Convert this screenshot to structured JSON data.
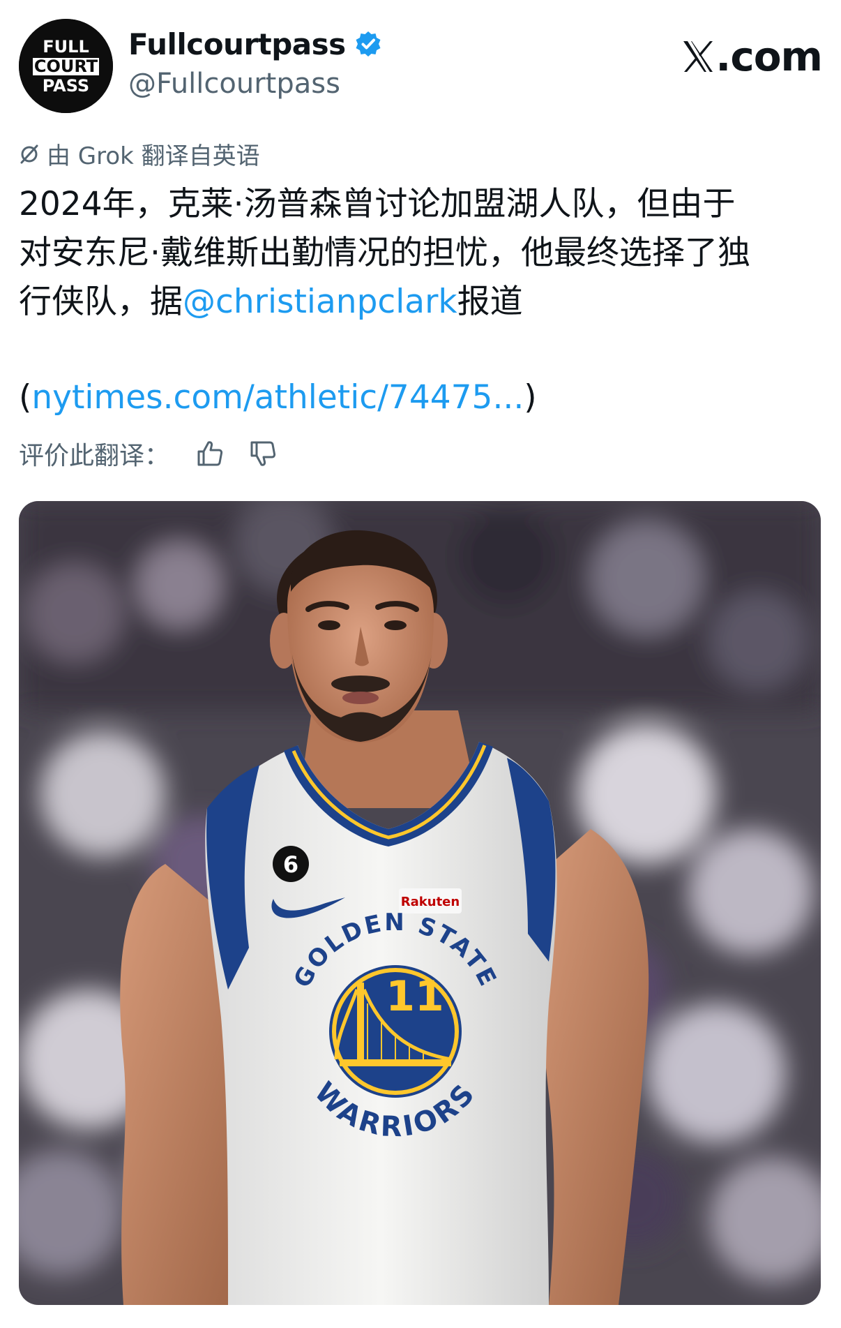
{
  "header": {
    "avatar_text": [
      "FULL",
      "COURT",
      "PASS"
    ],
    "display_name": "Fullcourtpass",
    "handle": "@Fullcourtpass",
    "verified_icon": "verified-badge-icon",
    "site": ".com"
  },
  "translation": {
    "label": "由 Grok 翻译自英语",
    "icon": "translate-icon"
  },
  "tweet": {
    "line1": "2024年，克莱·汤普森曾讨论加盟湖人队，但由于",
    "line2": "对安东尼·戴维斯出勤情况的担忧，他最终选择了独",
    "line3_pre": "行侠队，据",
    "mention": "@christianpclark",
    "line3_post": "报道",
    "link_open": "(",
    "link": "nytimes.com/athletic/74475...",
    "link_close": ")"
  },
  "rate": {
    "label": "评价此翻译：",
    "thumbs_up_icon": "thumbs-up-icon",
    "thumbs_down_icon": "thumbs-down-icon"
  },
  "media": {
    "jersey_top": "GOLDEN STATE",
    "jersey_bottom": "WARRIORS",
    "jersey_number": "11",
    "sponsor": "Rakuten",
    "patch_number": "6",
    "colors": {
      "warriors_blue": "#1d428a",
      "warriors_gold": "#ffc72c",
      "sponsor_red": "#bf0000",
      "jersey_white": "#f4f4f2"
    }
  }
}
